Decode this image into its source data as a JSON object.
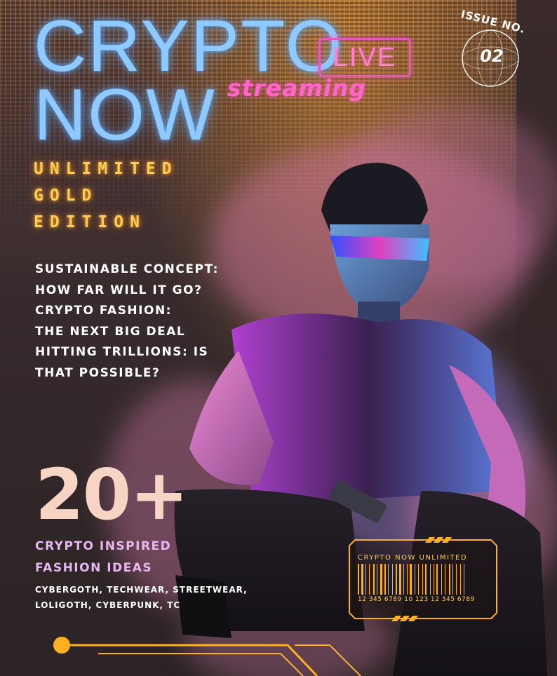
{
  "masthead": {
    "title_line1": "CRYPTO",
    "title_line2": "NOW",
    "live_label": "LIVE",
    "streaming_label": "streaming"
  },
  "issue": {
    "label": "ISSUE NO.",
    "number": "02"
  },
  "edition": {
    "line1": "UNLIMITED",
    "line2": "GOLD",
    "line3": "EDITION"
  },
  "headlines": [
    "Sustainable Concept:",
    "How far will it go?",
    "Crypto Fashion:",
    "The next big deal",
    "Hitting Trillions: Is",
    "that possible?"
  ],
  "feature": {
    "count": "20+",
    "line1": "CRYPTO INSPIRED",
    "line2": "FASHION IDEAS",
    "tags_line1": "CYBERGOTH, TECHWEAR, STREETWEAR,",
    "tags_line2": "LOLIGOTH, CYBERPUNK, TC"
  },
  "barcode": {
    "title": "CRYPTO NOW UNLIMITED",
    "numbers": "12 345 6789 10 123   12 345 6789"
  },
  "colors": {
    "title_blue": "#8ec9ff",
    "neon_pink": "#ff66c8",
    "gold": "#ffcc55",
    "peach": "#f7d4c3",
    "lilac": "#e9b6f3"
  }
}
